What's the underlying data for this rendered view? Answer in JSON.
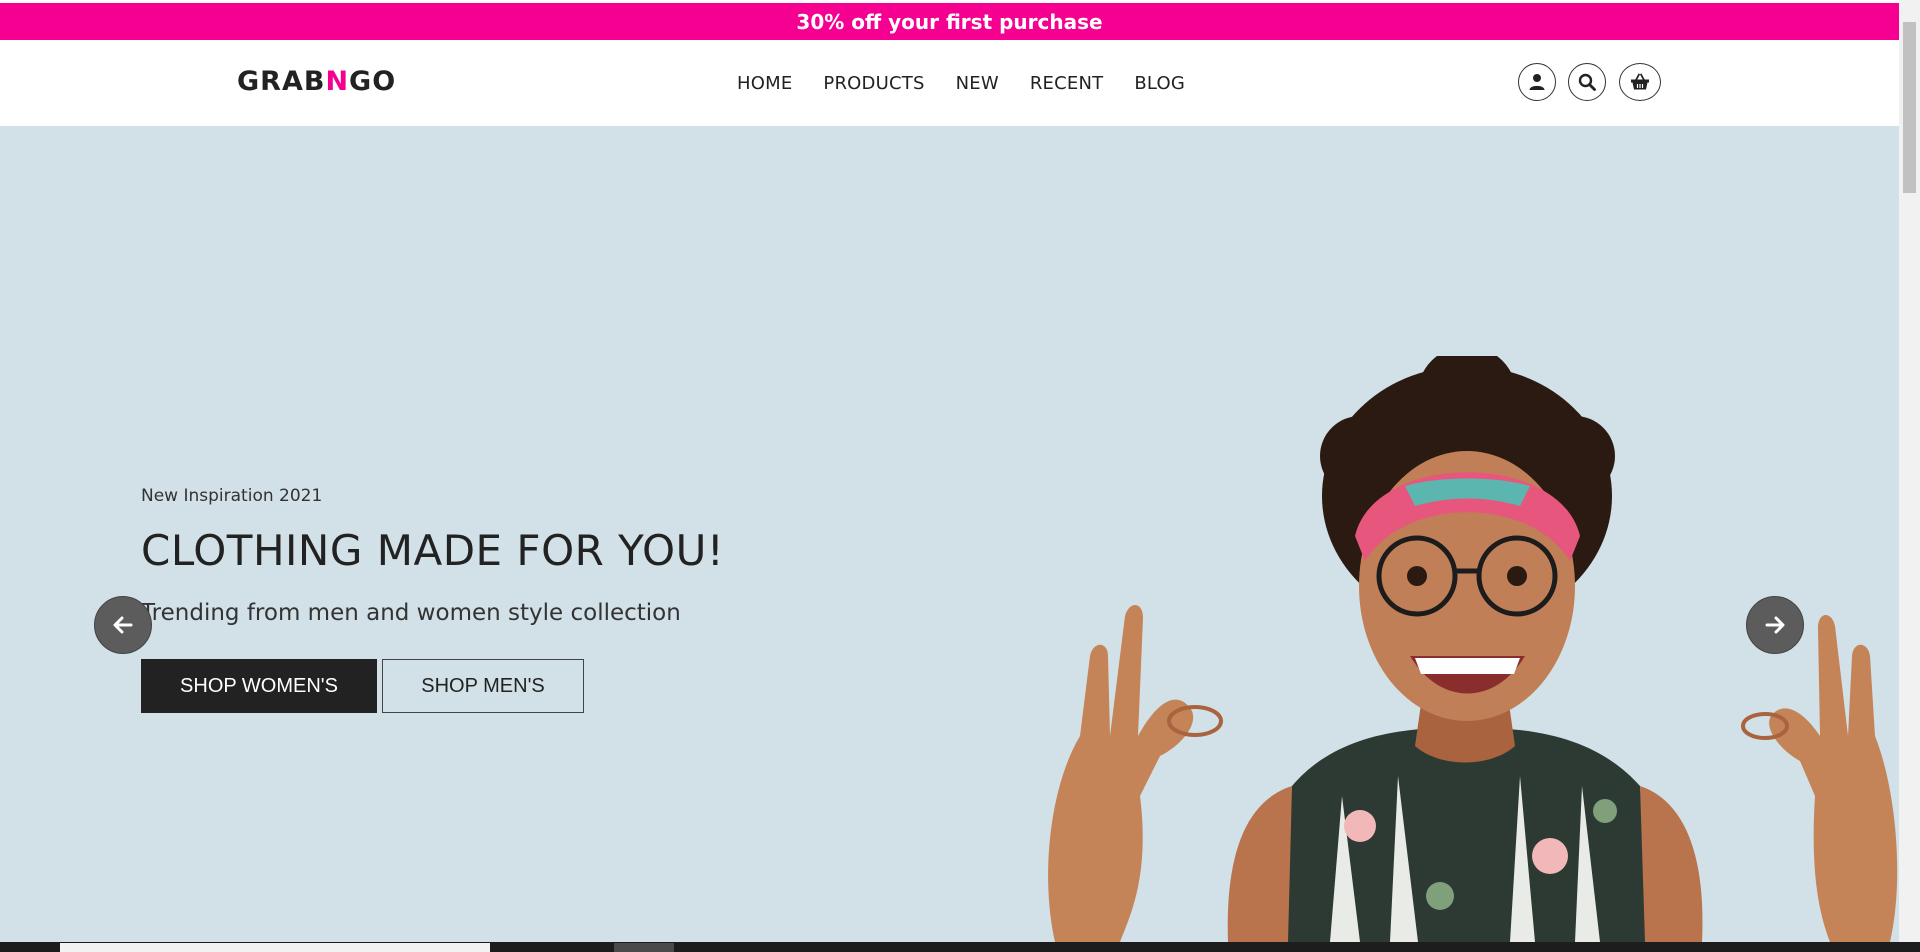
{
  "promo": {
    "text": "30% off your first purchase",
    "bg_color": "#f50090"
  },
  "header": {
    "logo": {
      "part1": "GRAB",
      "part2": "N",
      "part3": "GO",
      "accent_color": "#f50090"
    },
    "nav": [
      {
        "label": "HOME"
      },
      {
        "label": "PRODUCTS"
      },
      {
        "label": "NEW"
      },
      {
        "label": "RECENT"
      },
      {
        "label": "BLOG"
      }
    ],
    "icons": [
      "user-icon",
      "search-icon",
      "basket-icon"
    ]
  },
  "hero": {
    "bg_color": "#d1e1e7",
    "eyebrow": "New Inspiration 2021",
    "headline": "CLOTHING MADE FOR YOU!",
    "subline": "Trending from men and women style collection",
    "buttons": {
      "primary": "SHOP WOMEN'S",
      "secondary": "SHOP MEN'S"
    },
    "prev_icon": "arrow-left-icon",
    "next_icon": "arrow-right-icon",
    "image": "smiling woman with headband and glasses making ok signs"
  }
}
